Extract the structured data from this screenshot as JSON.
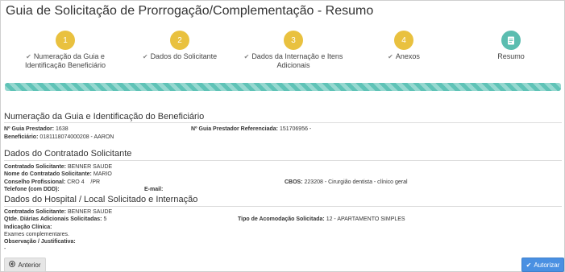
{
  "page": {
    "title": "Guia de Solicitação de Prorrogação/Complementação - Resumo"
  },
  "colors": {
    "step_pending": "#e9c13f",
    "step_current": "#5bbdb0",
    "progress": "#5fc3b7",
    "primary": "#4a90e2"
  },
  "steps": [
    {
      "number": "1",
      "label_line1": "Numeração da Guia e",
      "label_line2": "Identificação Beneficiário"
    },
    {
      "number": "2",
      "label_line1": "Dados do Solicitante",
      "label_line2": ""
    },
    {
      "number": "3",
      "label_line1": "Dados da Internação e Itens",
      "label_line2": "Adicionais"
    },
    {
      "number": "4",
      "label_line1": "Anexos",
      "label_line2": ""
    },
    {
      "icon": "document-icon",
      "label_line1": "Resumo",
      "label_line2": ""
    }
  ],
  "progress": {
    "percent": 100
  },
  "sections": {
    "guia": {
      "title": "Numeração da Guia e Identificação do Beneficiário",
      "n_guia_prestador_label": "Nº Guia Prestador:",
      "n_guia_prestador_value": "1638",
      "n_guia_referenciada_label": "Nº Guia Prestador Referenciada:",
      "n_guia_referenciada_value": "151706956 -",
      "beneficiario_label": "Beneficiário:",
      "beneficiario_value": "0181118074000208 - AARON"
    },
    "contratado": {
      "title": "Dados do Contratado Solicitante",
      "contratado_label": "Contratado Solicitante:",
      "contratado_value": "BENNER SAUDE",
      "nome_label": "Nome do Contratado Solicitante:",
      "nome_value": "MARIO",
      "conselho_label": "Conselho Profissional:",
      "conselho_value": "CRO 4",
      "conselho_uf": "/PR",
      "cbos_label": "CBOS:",
      "cbos_value": "223208 - Cirurgião dentista - clínico geral",
      "telefone_label": "Telefone (com DDD):",
      "email_label": "E-mail:"
    },
    "hospital": {
      "title": "Dados do Hospital / Local Solicitado e Internação",
      "contratado_label": "Contratado Solicitante:",
      "contratado_value": "BENNER SAUDE",
      "diarias_label": "Qtde. Diárias Adicionais Solicitadas:",
      "diarias_value": "5",
      "acomodacao_label": "Tipo de Acomodação Solicitada:",
      "acomodacao_value": "12 - APARTAMENTO SIMPLES",
      "indicacao_label": "Indicação Clínica:",
      "indicacao_value": "Exames complementares.",
      "observacao_label": "Observação / Justificativa:",
      "observacao_value": "-"
    }
  },
  "buttons": {
    "anterior": "Anterior",
    "autorizar": "Autorizar"
  }
}
